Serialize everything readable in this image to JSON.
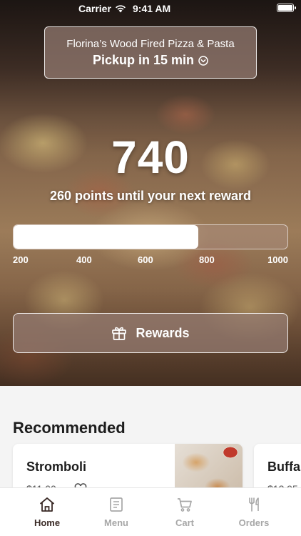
{
  "status_bar": {
    "carrier": "Carrier",
    "time": "9:41 AM"
  },
  "location": {
    "name": "Florina’s Wood Fired Pizza & Pasta",
    "pickup": "Pickup in 15 min"
  },
  "points": {
    "value": "740",
    "caption": "260 points until your next reward",
    "progress_current": 740,
    "progress_min": 200,
    "progress_max": 1000,
    "ticks": [
      "200",
      "400",
      "600",
      "800",
      "1000"
    ]
  },
  "rewards_button": {
    "label": "Rewards"
  },
  "recommended": {
    "title": "Recommended",
    "items": [
      {
        "name": "Stromboli",
        "price": "$11.00"
      },
      {
        "name": "Buffa",
        "price": "$12.95"
      }
    ]
  },
  "tab_bar": {
    "tabs": [
      {
        "label": "Home",
        "icon": "home-icon",
        "active": true
      },
      {
        "label": "Menu",
        "icon": "menu-icon",
        "active": false
      },
      {
        "label": "Cart",
        "icon": "cart-icon",
        "active": false
      },
      {
        "label": "Orders",
        "icon": "orders-icon",
        "active": false
      }
    ]
  },
  "colors": {
    "active_tab": "#3a2a26",
    "inactive_tab": "#a7a7a7",
    "progress_fill": "#ffffff"
  }
}
